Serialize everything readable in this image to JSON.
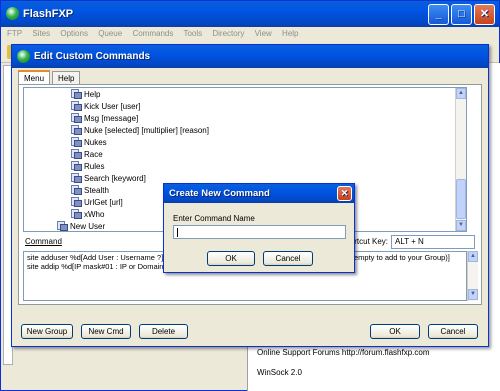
{
  "main_window": {
    "title": "FlashFXP",
    "menu": [
      "FTP",
      "Sites",
      "Options",
      "Queue",
      "Commands",
      "Tools",
      "Directory",
      "View",
      "Help"
    ],
    "status_lines": [
      "Online Support Forums http://forum.flashfxp.com",
      "WinSock 2.0"
    ]
  },
  "custom_commands_dialog": {
    "title": "Edit Custom Commands",
    "tabs": [
      "Menu",
      "Help"
    ],
    "tree_items": [
      "Help",
      "Kick User [user]",
      "Msg [message]",
      "Nuke [selected] [multiplier] [reason]",
      "Nukes",
      "Race",
      "Rules",
      "Search [keyword]",
      "Stealth",
      "UrlGet [url]",
      "xWho",
      "New User"
    ],
    "command_label": "Command",
    "shortcut_label": "Shortcut Key:",
    "shortcut_value": "ALT + N",
    "command_lines": [
      "site adduser %d[Add User : Username ?] %",
      "site addip %d[IP mask#01 : IP or Domaine"
    ],
    "command_tail": "empty to add to your Group)]",
    "buttons": {
      "new_group": "New Group",
      "new_cmd": "New Cmd",
      "delete": "Delete",
      "ok": "OK",
      "cancel": "Cancel"
    }
  },
  "create_command_dialog": {
    "title": "Create New Command",
    "label": "Enter Command Name",
    "input_value": "",
    "ok": "OK",
    "cancel": "Cancel"
  },
  "colors": {
    "title_blue": "#0054e3",
    "dialog_face": "#ece9d8",
    "close_red": "#c8401b"
  }
}
